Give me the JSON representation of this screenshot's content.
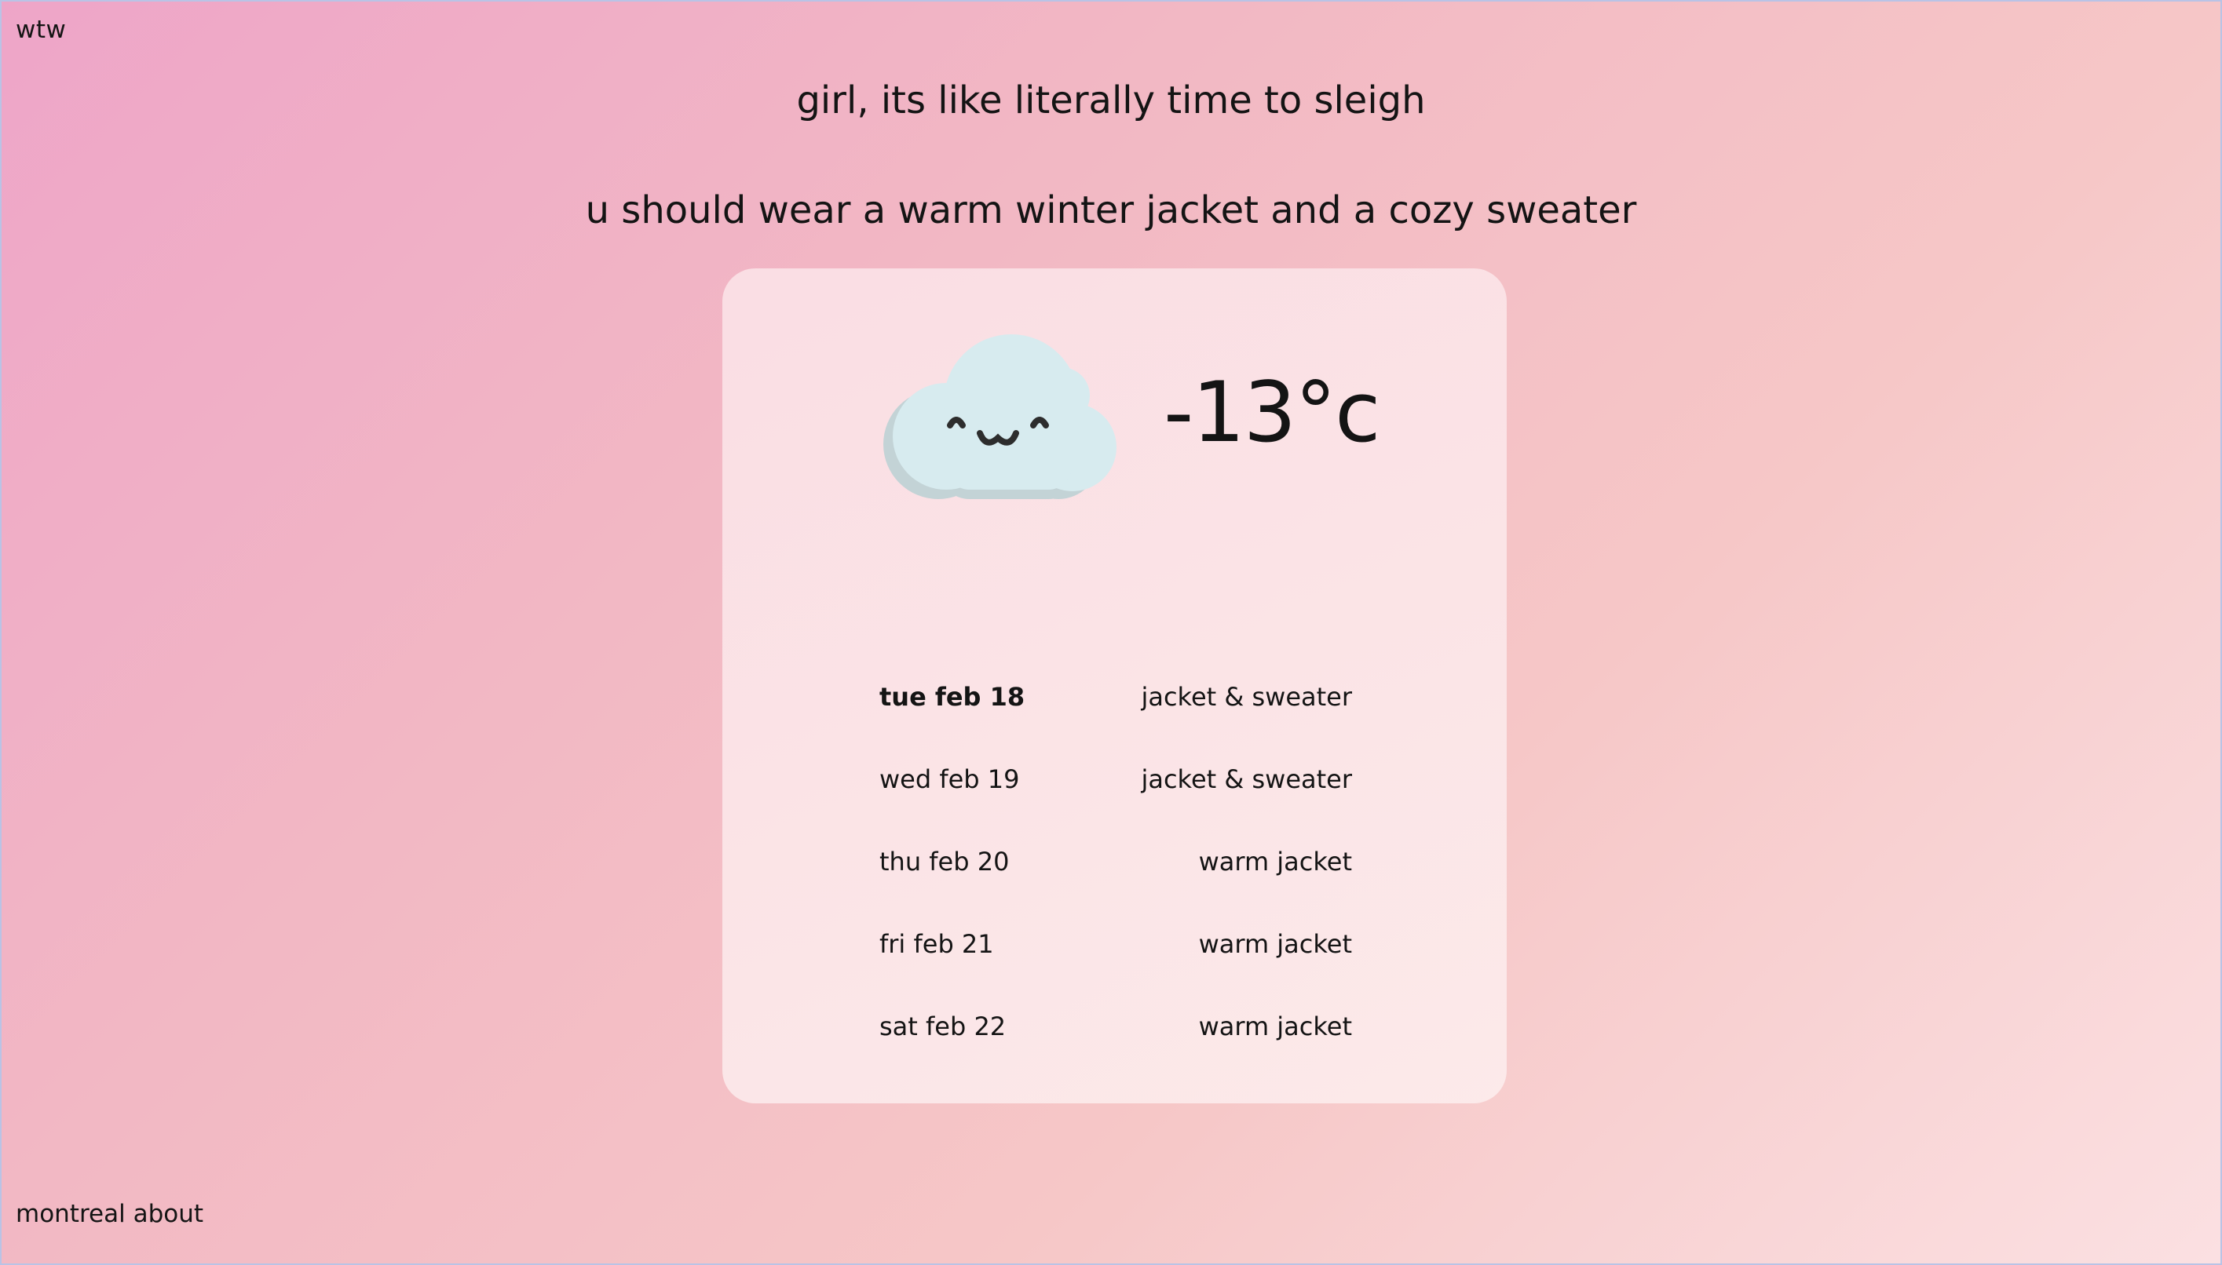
{
  "brand": "wtw",
  "headline": "girl, its like literally time to sleigh",
  "advice": "u should wear a warm winter jacket and a cozy sweater",
  "weather": {
    "icon": "cloud-face-icon",
    "temperature": "-13°c"
  },
  "forecast": [
    {
      "day": "tue feb 18",
      "outfit": "jacket & sweater"
    },
    {
      "day": "wed feb 19",
      "outfit": "jacket & sweater"
    },
    {
      "day": "thu feb 20",
      "outfit": "warm jacket"
    },
    {
      "day": "fri feb 21",
      "outfit": "warm jacket"
    },
    {
      "day": "sat feb 22",
      "outfit": "warm jacket"
    }
  ],
  "footer": {
    "city": "montreal",
    "about": "about"
  },
  "colors": {
    "cloud": "#d7ebef",
    "cloud_shadow": "#c3d3d6",
    "face": "#2d2d2d"
  }
}
